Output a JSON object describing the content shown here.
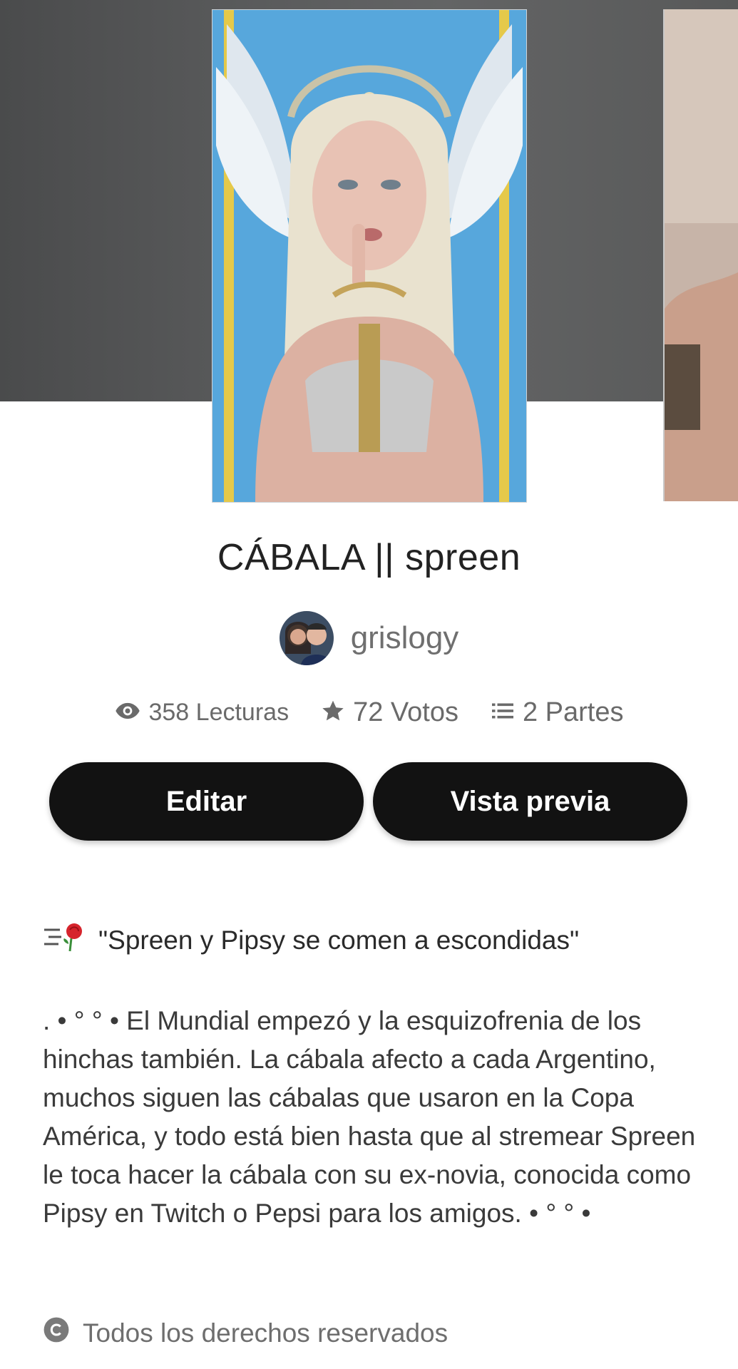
{
  "story": {
    "title": "CÁBALA || spreen",
    "author": "grislogy"
  },
  "stats": {
    "reads": "358 Lecturas",
    "votes": "72 Votos",
    "parts": "2 Partes"
  },
  "actions": {
    "edit_label": "Editar",
    "preview_label": "Vista previa"
  },
  "description": {
    "tagline": "\"Spreen y Pipsy se comen a escondidas\"",
    "body": ". • ° °    • El Mundial empezó y la esquizofrenia de los hinchas también. La cábala afecto a cada Argentino, muchos siguen las cábalas que usaron en la Copa América, y todo está bien hasta que al stremear Spreen le toca hacer la cábala con su ex-novia, conocida como Pipsy en Twitch o Pepsi para los amigos. • °  °    •"
  },
  "footer": {
    "rights": "Todos los derechos reservados"
  },
  "icons": {
    "reads": "eye-icon",
    "votes": "star-icon",
    "parts": "list-icon",
    "tagline": "rose-icon",
    "rights": "copyright-icon"
  },
  "colors": {
    "button_bg": "#121212",
    "button_text": "#ffffff",
    "muted_text": "#6a6a6a",
    "hero_bg": "#5a5b5c"
  }
}
